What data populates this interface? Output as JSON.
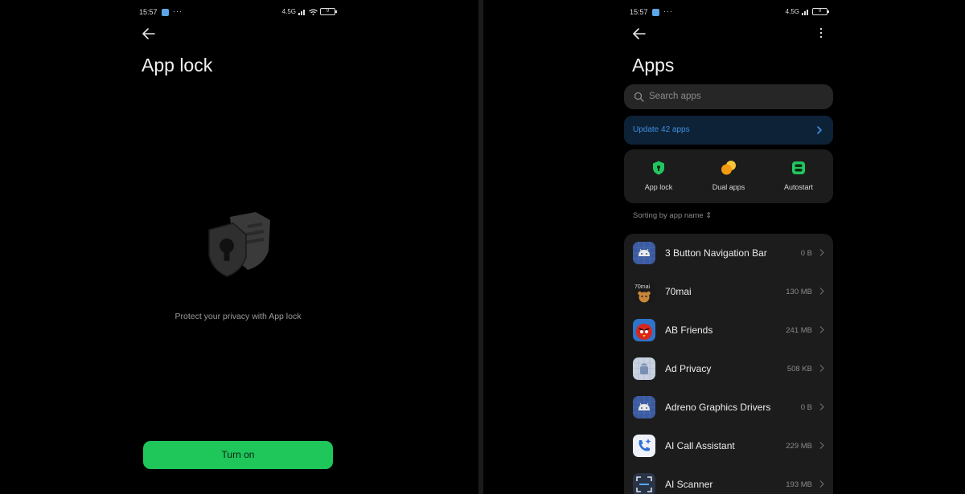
{
  "left": {
    "status": {
      "time": "15:57",
      "dots": "···",
      "net": "4.5G",
      "battery": "9"
    },
    "title": "App lock",
    "privacy_text": "Protect your privacy with App lock",
    "turn_on_label": "Turn on",
    "accent": "#1fc65a"
  },
  "right": {
    "status": {
      "time": "15:57",
      "dots": "···",
      "net": "4.5G",
      "battery": "9"
    },
    "title": "Apps",
    "search_placeholder": "Search apps",
    "update_label": "Update 42 apps",
    "shortcuts": [
      {
        "label": "App lock",
        "icon": "shield-icon"
      },
      {
        "label": "Dual apps",
        "icon": "dual-circles-icon"
      },
      {
        "label": "Autostart",
        "icon": "autostart-icon"
      }
    ],
    "sorting_label": "Sorting by app name ⇕",
    "apps": [
      {
        "name": "3 Button Navigation Bar",
        "size": "0 B",
        "icon": "android-icon"
      },
      {
        "name": "70mai",
        "size": "130 MB",
        "icon": "70mai-icon"
      },
      {
        "name": "AB Friends",
        "size": "241 MB",
        "icon": "angry-bird-icon"
      },
      {
        "name": "Ad Privacy",
        "size": "508 KB",
        "icon": "android-icon"
      },
      {
        "name": "Adreno Graphics Drivers",
        "size": "0 B",
        "icon": "android-icon"
      },
      {
        "name": "AI Call Assistant",
        "size": "229 MB",
        "icon": "phone-sparkle-icon"
      },
      {
        "name": "AI Scanner",
        "size": "193 MB",
        "icon": "scanner-icon"
      }
    ],
    "colors": {
      "link": "#3d8ee0",
      "shield": "#22c55e",
      "dual": "#f5b41a",
      "autostart": "#22c55e"
    }
  }
}
